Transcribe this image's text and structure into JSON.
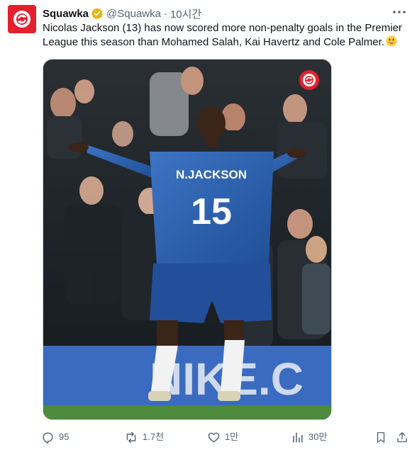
{
  "author": {
    "name": "Squawka",
    "handle": "@Squawka",
    "separator": "·",
    "time": "10시간",
    "verified": true
  },
  "tweet": {
    "text": "Nicolas Jackson (13) has now scored more non-penalty goals in the Premier League this season than Mohamed Salah, Kai Havertz and Cole Palmer.",
    "emoji": "grinning-face"
  },
  "media": {
    "kind": "photo",
    "jersey_name": "N.JACKSON",
    "jersey_number": "15",
    "board_text": "NIKE.C"
  },
  "actions": {
    "reply_count": "95",
    "retweet_count": "1.7천",
    "like_count": "1만",
    "views_count": "30만"
  },
  "colors": {
    "brand_red": "#e4202e",
    "verified_gold": "#e2b719",
    "muted": "#536471",
    "text": "#0f1419"
  },
  "icons": [
    "reply-icon",
    "retweet-icon",
    "like-icon",
    "views-icon",
    "bookmark-icon",
    "share-icon",
    "more-icon"
  ]
}
